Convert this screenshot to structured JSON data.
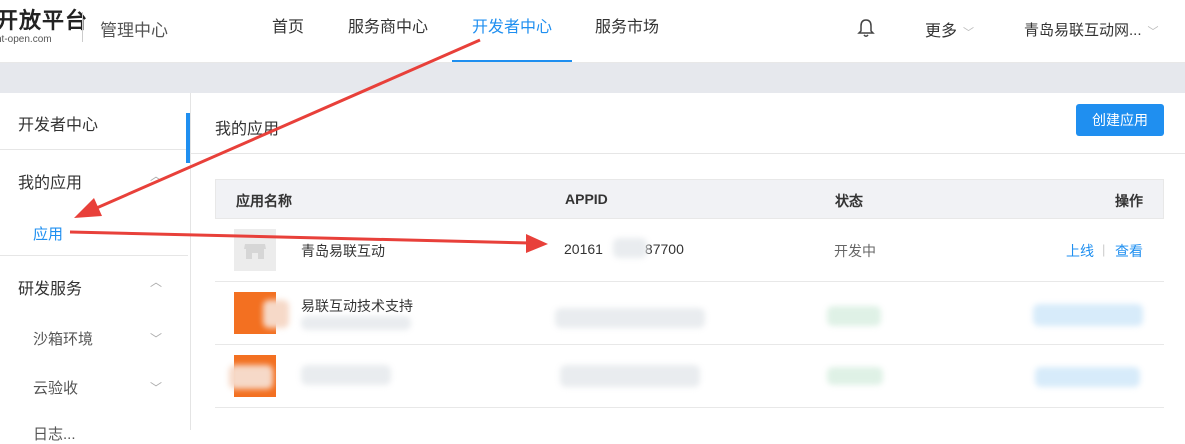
{
  "header": {
    "logo_text": "开放平台",
    "logo_domain": "nt-open.com",
    "section_label": "管理中心",
    "nav": [
      "首页",
      "服务商中心",
      "开发者中心",
      "服务市场"
    ],
    "more_label": "更多",
    "company_name": "青岛易联互动网..."
  },
  "sidebar": {
    "title": "开发者中心",
    "groups": [
      {
        "label": "我的应用",
        "items": [
          "应用"
        ]
      },
      {
        "label": "研发服务",
        "items": [
          "沙箱环境",
          "云验收",
          "日志..."
        ]
      }
    ]
  },
  "main": {
    "title": "我的应用",
    "create_button": "创建应用",
    "table": {
      "columns": [
        "应用名称",
        "APPID",
        "状态",
        "操作"
      ],
      "rows": [
        {
          "name": "青岛易联互动",
          "appid": "20161   87700",
          "status": "开发中",
          "actions": [
            "上线",
            "查看"
          ]
        },
        {
          "name": "易联互动技术支持",
          "appid": "",
          "status": "",
          "actions": []
        },
        {
          "name": "",
          "appid": "",
          "status": "",
          "actions": []
        }
      ]
    }
  },
  "colors": {
    "accent": "#1f8ff0",
    "annotation_red": "#e8403a"
  },
  "icons": [
    "bell-icon",
    "chevron-down-icon",
    "chevron-up-icon",
    "store-icon"
  ]
}
